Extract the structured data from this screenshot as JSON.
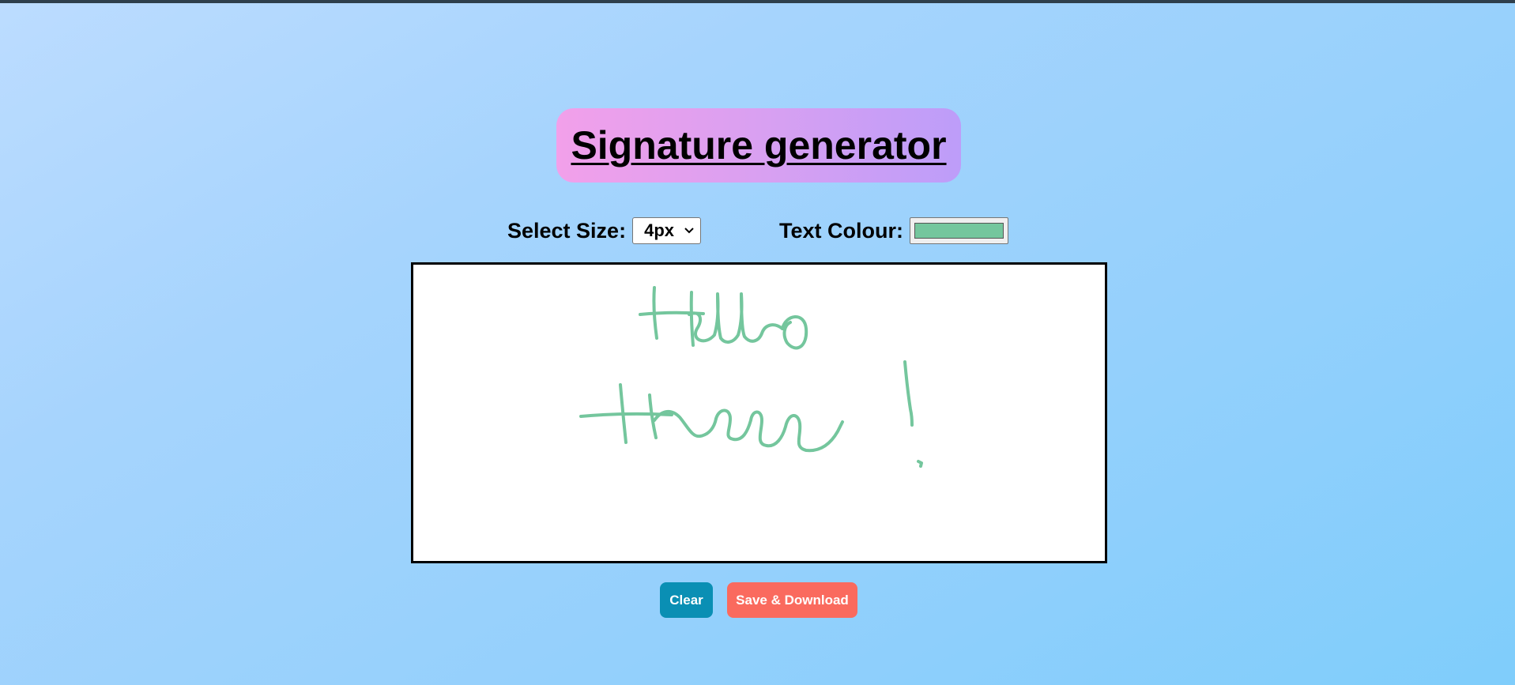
{
  "page": {
    "title": "Signature generator"
  },
  "controls": {
    "size_label": "Select Size:",
    "size_value": "4px",
    "color_label": "Text Colour:",
    "color_value": "#74c69d"
  },
  "canvas": {
    "stroke_color": "#74c69d",
    "stroke_width_label": "4px"
  },
  "buttons": {
    "clear_label": "Clear",
    "save_label": "Save & Download"
  },
  "colors": {
    "title_gradient_start": "#f2a0ea",
    "title_gradient_end": "#bd9df9",
    "clear_button": "#0a8fb4",
    "save_button": "#fa6a5e",
    "canvas_border": "#000000",
    "canvas_background": "#ffffff"
  }
}
